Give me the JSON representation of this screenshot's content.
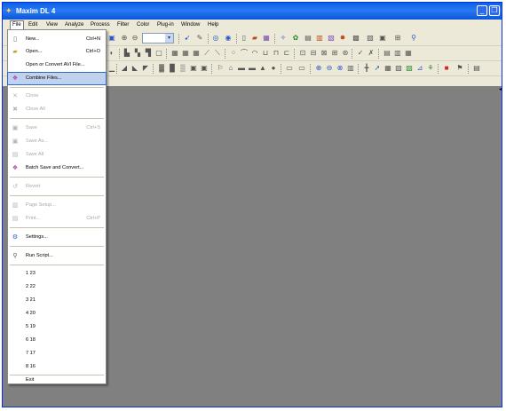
{
  "window": {
    "title": "Maxim DL 4",
    "minimize_glyph": "_",
    "maximize_glyph": "❐"
  },
  "menubar": [
    {
      "label": "File"
    },
    {
      "label": "Edit"
    },
    {
      "label": "View"
    },
    {
      "label": "Analyze"
    },
    {
      "label": "Process"
    },
    {
      "label": "Filter"
    },
    {
      "label": "Color"
    },
    {
      "label": "Plug-in"
    },
    {
      "label": "Window"
    },
    {
      "label": "Help"
    }
  ],
  "file_menu": {
    "items": [
      {
        "label": "New...",
        "shortcut": "Ctrl+N",
        "icon": "new-file-icon",
        "enabled": true
      },
      {
        "label": "Open...",
        "shortcut": "Ctrl+O",
        "icon": "open-folder-icon",
        "enabled": true
      },
      {
        "label": "Open or Convert AVI File...",
        "shortcut": "",
        "icon": "",
        "enabled": true
      },
      {
        "label": "Combine Files...",
        "shortcut": "",
        "icon": "combine-files-icon",
        "enabled": true,
        "highlighted": true
      },
      {
        "label": "Close",
        "shortcut": "",
        "icon": "close-icon",
        "enabled": false
      },
      {
        "label": "Close All",
        "shortcut": "",
        "icon": "close-all-icon",
        "enabled": false
      },
      {
        "label": "Save",
        "shortcut": "Ctrl+S",
        "icon": "save-icon",
        "enabled": false
      },
      {
        "label": "Save As...",
        "shortcut": "",
        "icon": "save-as-icon",
        "enabled": false
      },
      {
        "label": "Save All",
        "shortcut": "",
        "icon": "save-all-icon",
        "enabled": false
      },
      {
        "label": "Batch Save and Convert...",
        "shortcut": "",
        "icon": "batch-convert-icon",
        "enabled": true
      },
      {
        "label": "Revert",
        "shortcut": "",
        "icon": "revert-icon",
        "enabled": false
      },
      {
        "label": "Page Setup...",
        "shortcut": "",
        "icon": "page-setup-icon",
        "enabled": false
      },
      {
        "label": "Print...",
        "shortcut": "Ctrl+P",
        "icon": "print-icon",
        "enabled": false
      },
      {
        "label": "Settings...",
        "shortcut": "",
        "icon": "settings-icon",
        "enabled": true
      },
      {
        "label": "Run Script...",
        "shortcut": "",
        "icon": "run-script-icon",
        "enabled": true
      },
      {
        "label": "1 23",
        "shortcut": "",
        "icon": "",
        "enabled": true
      },
      {
        "label": "2 22",
        "shortcut": "",
        "icon": "",
        "enabled": true
      },
      {
        "label": "3 21",
        "shortcut": "",
        "icon": "",
        "enabled": true
      },
      {
        "label": "4 20",
        "shortcut": "",
        "icon": "",
        "enabled": true
      },
      {
        "label": "5 19",
        "shortcut": "",
        "icon": "",
        "enabled": true
      },
      {
        "label": "6 18",
        "shortcut": "",
        "icon": "",
        "enabled": true
      },
      {
        "label": "7 17",
        "shortcut": "",
        "icon": "",
        "enabled": true
      },
      {
        "label": "8 16",
        "shortcut": "",
        "icon": "",
        "enabled": true
      },
      {
        "label": "Exit",
        "shortcut": "",
        "icon": "",
        "enabled": true
      }
    ]
  },
  "colors": {
    "titlebar": "#0a5fe6",
    "workspace": "#808080",
    "chrome": "#ece9d8",
    "highlight": "#c1d2ee"
  }
}
